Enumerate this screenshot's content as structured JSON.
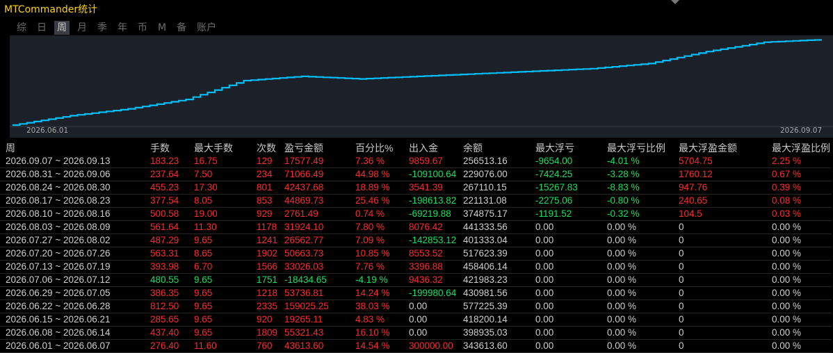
{
  "window": {
    "title": "MTCommander统计"
  },
  "tabs": [
    "综",
    "日",
    "周",
    "月",
    "季",
    "年",
    "币",
    "M",
    "备",
    "账户"
  ],
  "active_tab": "周",
  "chart_data": {
    "type": "line",
    "x_start_label": "2026.06.01",
    "x_end_label": "2026.09.07",
    "series_color": "#00bfff",
    "x": [
      "2026.06.01",
      "2026.06.08",
      "2026.06.15",
      "2026.06.22",
      "2026.06.29",
      "2026.07.06",
      "2026.07.13",
      "2026.07.20",
      "2026.07.27",
      "2026.08.03",
      "2026.08.10",
      "2026.08.17",
      "2026.08.24",
      "2026.08.31",
      "2026.09.07"
    ],
    "values": [
      343613.6,
      398935.03,
      418200.14,
      577225.39,
      430981.56,
      421983.23,
      458406.14,
      517623.39,
      401333.04,
      441333.56,
      374875.17,
      221131.08,
      267110.15,
      229076.0,
      256513.16
    ],
    "curve": [
      0,
      0.11,
      0.19,
      0.3,
      0.52,
      0.57,
      0.54,
      0.57,
      0.6,
      0.63,
      0.66,
      0.72,
      0.86,
      0.97,
      1.0
    ]
  },
  "table": {
    "headers": [
      "周",
      "手数",
      "最大手数",
      "次数",
      "盈亏金额",
      "百分比%",
      "出入金",
      "余额",
      "最大浮亏",
      "最大浮亏比例",
      "最大浮盈金额",
      "最大浮盈比例"
    ],
    "rows": [
      [
        "2026.09.07 ~ 2026.09.13",
        "183.23",
        "16.75",
        "129",
        "17577.49",
        "7.36 %",
        "9859.67",
        "256513.16",
        "-9654.00",
        "-4.01 %",
        "5704.75",
        "2.25 %"
      ],
      [
        "2026.08.31 ~ 2026.09.06",
        "237.64",
        "7.50",
        "234",
        "71066.49",
        "44.98 %",
        "-109100.64",
        "229076.00",
        "-7424.25",
        "-3.28 %",
        "1760.12",
        "0.67 %"
      ],
      [
        "2026.08.24 ~ 2026.08.30",
        "455.23",
        "17.30",
        "801",
        "42437.68",
        "18.89 %",
        "3541.39",
        "267110.15",
        "-15267.83",
        "-8.83 %",
        "947.76",
        "0.39 %"
      ],
      [
        "2026.08.17 ~ 2026.08.23",
        "377.54",
        "8.05",
        "853",
        "44869.73",
        "25.46 %",
        "-198613.82",
        "221131.08",
        "-2275.06",
        "-0.80 %",
        "240.65",
        "0.08 %"
      ],
      [
        "2026.08.10 ~ 2026.08.16",
        "500.58",
        "19.00",
        "929",
        "2761.49",
        "0.74 %",
        "-69219.88",
        "374875.17",
        "-1191.52",
        "-0.32 %",
        "104.5",
        "0.03 %"
      ],
      [
        "2026.08.03 ~ 2026.08.09",
        "561.64",
        "11.30",
        "1178",
        "31924.10",
        "7.80 %",
        "8076.42",
        "441333.56",
        "0.00",
        "0.00 %",
        "0",
        "0.00 %"
      ],
      [
        "2026.07.27 ~ 2026.08.02",
        "487.29",
        "9.65",
        "1241",
        "26562.77",
        "7.09 %",
        "-142853.12",
        "401333.04",
        "0.00",
        "0.00 %",
        "0",
        "0.00 %"
      ],
      [
        "2026.07.20 ~ 2026.07.26",
        "563.31",
        "8.65",
        "1902",
        "50663.73",
        "10.85 %",
        "8553.52",
        "517623.39",
        "0.00",
        "0.00 %",
        "0",
        "0.00 %"
      ],
      [
        "2026.07.13 ~ 2026.07.19",
        "393.98",
        "6.70",
        "1566",
        "33026.03",
        "7.76 %",
        "3396.88",
        "458406.14",
        "0.00",
        "0.00 %",
        "0",
        "0.00 %"
      ],
      [
        "2026.07.06 ~ 2026.07.12",
        "480.55",
        "9.65",
        "1751",
        "-18434.65",
        "-4.19 %",
        "9436.32",
        "421983.23",
        "0.00",
        "0.00 %",
        "0",
        "0.00 %"
      ],
      [
        "2026.06.29 ~ 2026.07.05",
        "386.35",
        "9.65",
        "1218",
        "53736.81",
        "14.24 %",
        "-199980.64",
        "430981.56",
        "0.00",
        "0.00 %",
        "0",
        "0.00 %"
      ],
      [
        "2026.06.22 ~ 2026.06.28",
        "812.50",
        "9.65",
        "2335",
        "159025.25",
        "38.03 %",
        "0.00",
        "577225.39",
        "0.00",
        "0.00 %",
        "0",
        "0.00 %"
      ],
      [
        "2026.06.15 ~ 2026.06.21",
        "285.65",
        "9.65",
        "920",
        "19265.11",
        "4.83 %",
        "0.00",
        "418200.14",
        "0.00",
        "0.00 %",
        "0",
        "0.00 %"
      ],
      [
        "2026.06.08 ~ 2026.06.14",
        "437.40",
        "9.65",
        "1809",
        "55321.43",
        "16.10 %",
        "0.00",
        "398935.03",
        "0.00",
        "0.00 %",
        "0",
        "0.00 %"
      ],
      [
        "2026.06.01 ~ 2026.06.07",
        "276.40",
        "11.60",
        "760",
        "43613.60",
        "14.54 %",
        "300000.00",
        "343613.60",
        "0.00",
        "0.00 %",
        "0",
        "0.00 %"
      ]
    ]
  }
}
